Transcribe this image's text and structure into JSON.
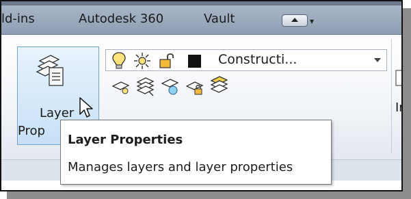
{
  "tabs": [
    {
      "label": "ld-ins"
    },
    {
      "label": "Autodesk 360"
    },
    {
      "label": "Vault"
    }
  ],
  "tab_menu": {
    "caret": "▾",
    "icon": "window-dropdown-icon"
  },
  "layer_button": {
    "label_line1": "Layer",
    "label_line2": "Prop",
    "icon": "layer-properties-icon"
  },
  "layer_combo": {
    "value": "Constructi...",
    "swatch_color": "#111111",
    "icons": [
      "bulb-icon",
      "sun-icon",
      "unlock-icon"
    ]
  },
  "layer_tools": [
    "layer-isolate-icon",
    "layer-match-icon",
    "layer-freeze-icon",
    "layer-lock-icon",
    "layer-states-icon"
  ],
  "right_panel": {
    "label": "Ir"
  },
  "tooltip": {
    "title": "Layer Properties",
    "description": "Manages layers and layer properties"
  }
}
